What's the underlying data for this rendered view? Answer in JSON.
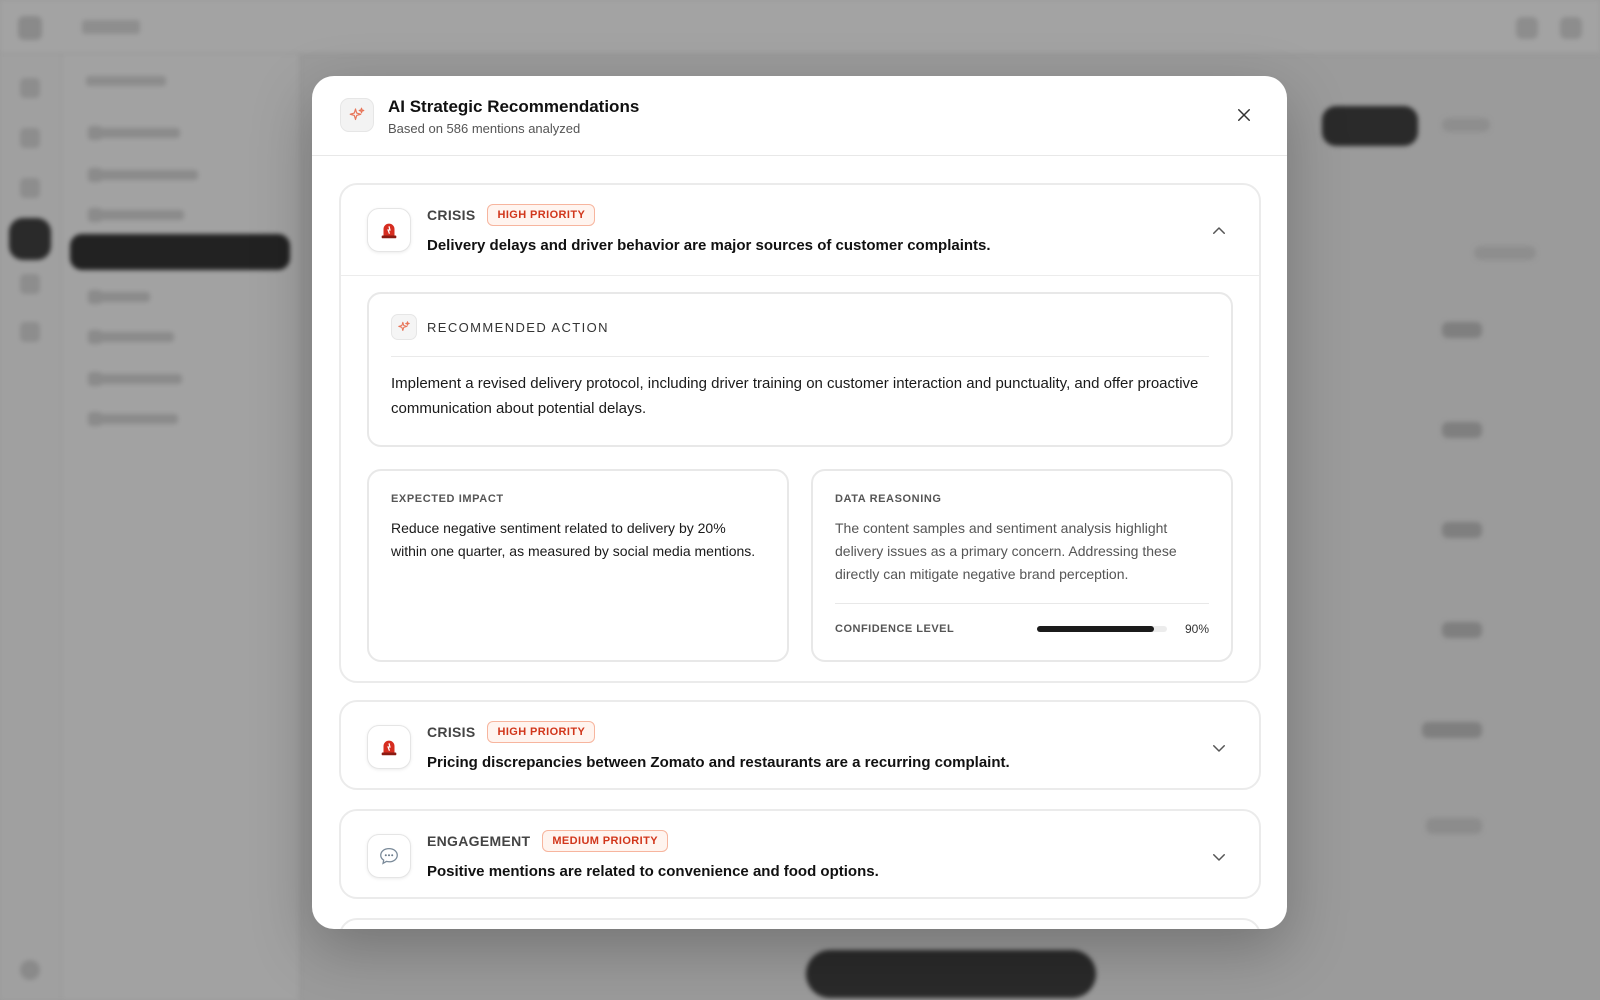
{
  "modal": {
    "title": "AI Strategic Recommendations",
    "subtitle": "Based on 586 mentions analyzed",
    "icon": "sparkle-icon",
    "close_icon": "close-icon"
  },
  "recommendations": [
    {
      "category": "CRISIS",
      "priority": "HIGH PRIORITY",
      "icon": "alarm-siren-icon",
      "title": "Delivery delays and driver behavior are major sources of customer complaints.",
      "expanded": true,
      "action_label": "RECOMMENDED ACTION",
      "action_text": "Implement a revised delivery protocol, including driver training on customer interaction and punctuality, and offer proactive communication about potential delays.",
      "impact_label": "EXPECTED IMPACT",
      "impact_text": "Reduce negative sentiment related to delivery by 20% within one quarter, as measured by social media mentions.",
      "reasoning_label": "DATA REASONING",
      "reasoning_text": "The content samples and sentiment analysis highlight delivery issues as a primary concern. Addressing these directly can mitigate negative brand perception.",
      "confidence_label": "CONFIDENCE LEVEL",
      "confidence_value": "90%",
      "confidence_fraction": 0.9
    },
    {
      "category": "CRISIS",
      "priority": "HIGH PRIORITY",
      "icon": "alarm-siren-icon",
      "title": "Pricing discrepancies between Zomato and restaurants are a recurring complaint.",
      "expanded": false
    },
    {
      "category": "ENGAGEMENT",
      "priority": "MEDIUM PRIORITY",
      "icon": "speech-bubble-icon",
      "title": "Positive mentions are related to convenience and food options.",
      "expanded": false
    }
  ],
  "colors": {
    "priority_text": "#d1361b",
    "priority_bg": "#fff4ef",
    "accent_sparkle": "#e8765a",
    "siren_red": "#d62d20"
  }
}
